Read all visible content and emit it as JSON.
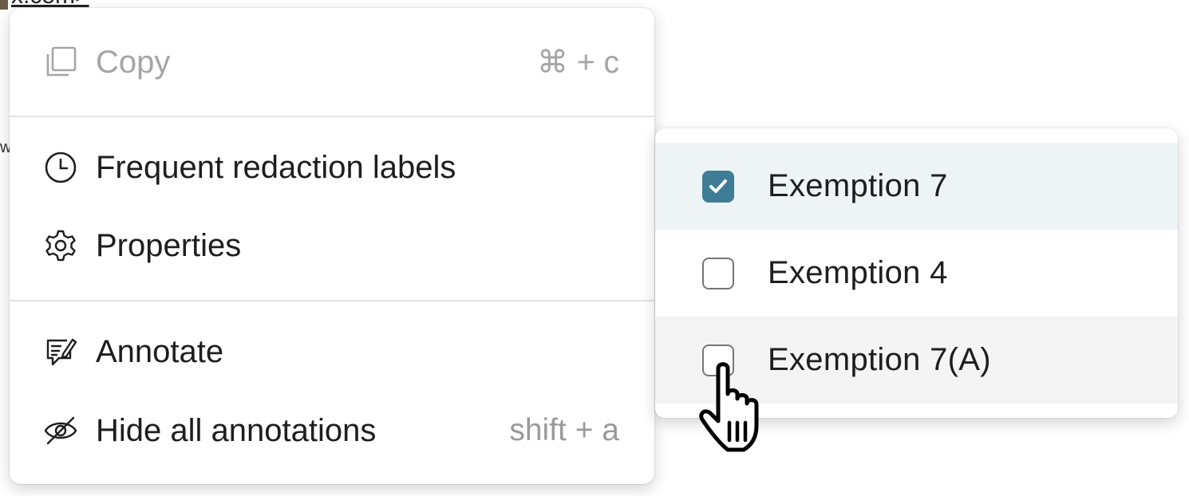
{
  "background": {
    "link_fragment": "x.com>",
    "edge_fragment": "w",
    "right_fragment": "·"
  },
  "context_menu": {
    "items": [
      {
        "id": "copy",
        "label": "Copy",
        "icon": "copy-icon",
        "shortcut": "⌘ + c",
        "disabled": true
      },
      {
        "id": "frequent",
        "label": "Frequent redaction labels",
        "icon": "clock-icon",
        "shortcut": ""
      },
      {
        "id": "properties",
        "label": "Properties",
        "icon": "gear-icon",
        "shortcut": ""
      },
      {
        "id": "annotate",
        "label": "Annotate",
        "icon": "annotate-icon",
        "shortcut": ""
      },
      {
        "id": "hide",
        "label": "Hide all annotations",
        "icon": "eye-slash-icon",
        "shortcut": "shift + a"
      }
    ]
  },
  "submenu": {
    "items": [
      {
        "label": "Exemption 7",
        "checked": true,
        "state": "selected"
      },
      {
        "label": "Exemption 4",
        "checked": false,
        "state": "normal"
      },
      {
        "label": "Exemption 7(A)",
        "checked": false,
        "state": "hovered"
      }
    ]
  },
  "colors": {
    "accent": "#3f7d96",
    "selected_bg": "#eef3f5",
    "hover_bg": "#f4f4f4",
    "disabled_text": "#a5a5a5"
  }
}
